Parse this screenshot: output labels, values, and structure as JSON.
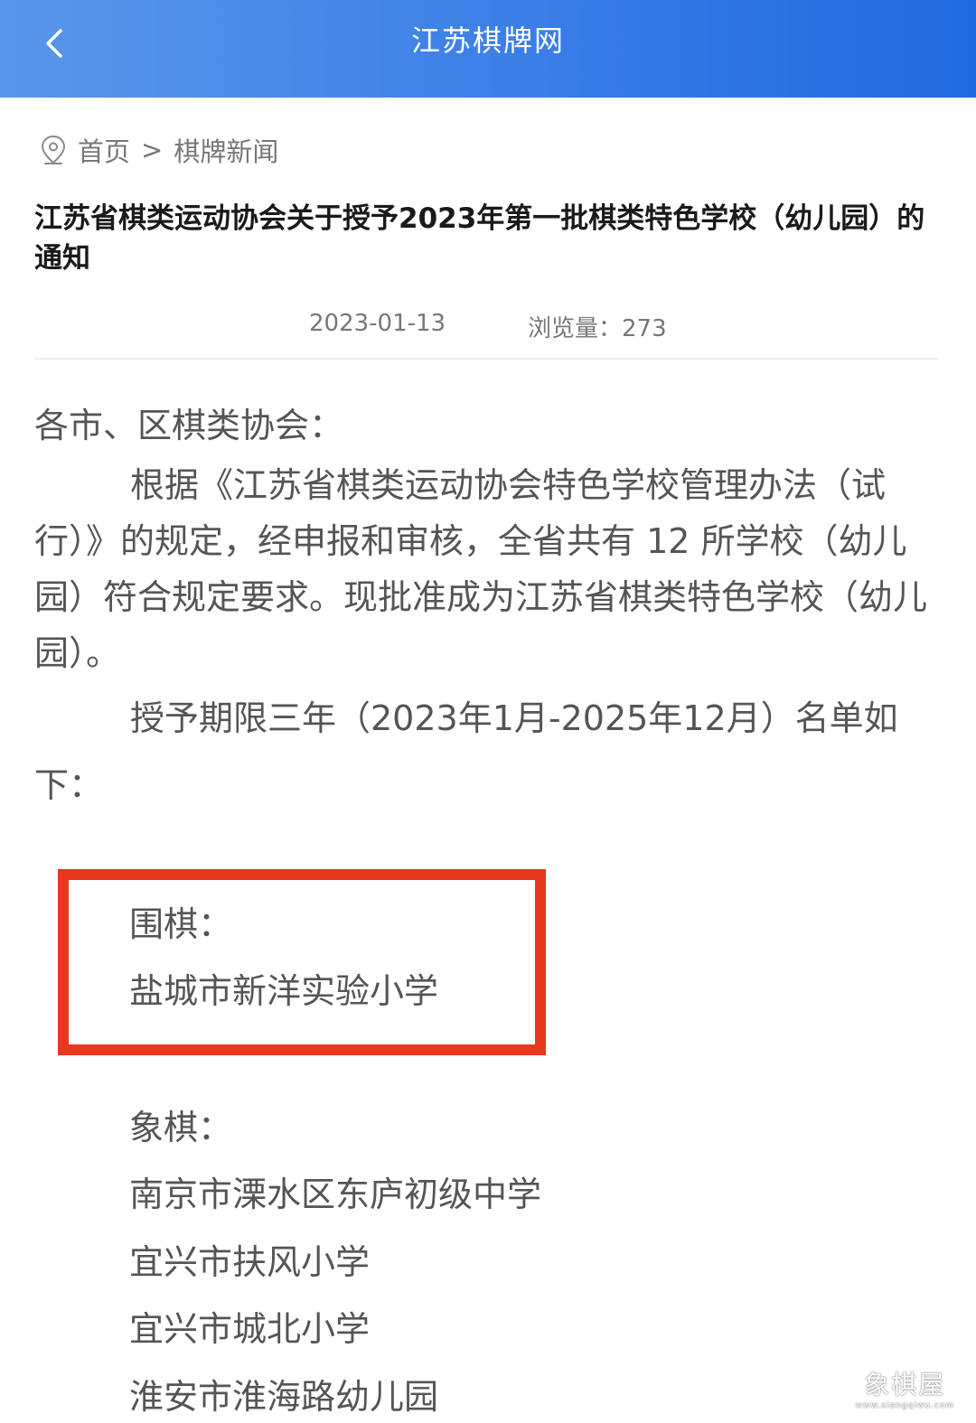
{
  "header": {
    "title": "江苏棋牌网"
  },
  "breadcrumb": {
    "home": "首页",
    "separator": ">",
    "current": "棋牌新闻"
  },
  "article": {
    "title": "江苏省棋类运动协会关于授予2023年第一批棋类特色学校（幼儿园）的通知",
    "date": "2023-01-13",
    "views": "浏览量：273",
    "salutation": "各市、区棋类协会：",
    "paragraph1": "根据《江苏省棋类运动协会特色学校管理办法（试行）》的规定，经申报和审核，全省共有 12 所学校（幼儿园）符合规定要求。现批准成为江苏省棋类特色学校（幼儿园）。",
    "paragraph2": "授予期限三年（2023年1月-2025年12月）名单如下：",
    "weiqi_heading": "围棋：",
    "weiqi_schools": [
      "盐城市新洋实验小学"
    ],
    "xiangqi_heading": "象棋：",
    "xiangqi_schools": [
      "南京市溧水区东庐初级中学",
      "宜兴市扶风小学",
      "宜兴市城北小学",
      "淮安市淮海路幼儿园"
    ]
  },
  "watermark": {
    "title": "象棋屋",
    "url": "www.xiangqiwu.com"
  },
  "colors": {
    "header_start": "#5a96ea",
    "header_end": "#1f6ae0",
    "highlight_border": "#e8361f"
  },
  "icons": {
    "back": "chevron-left-icon",
    "location": "location-pin-icon"
  }
}
